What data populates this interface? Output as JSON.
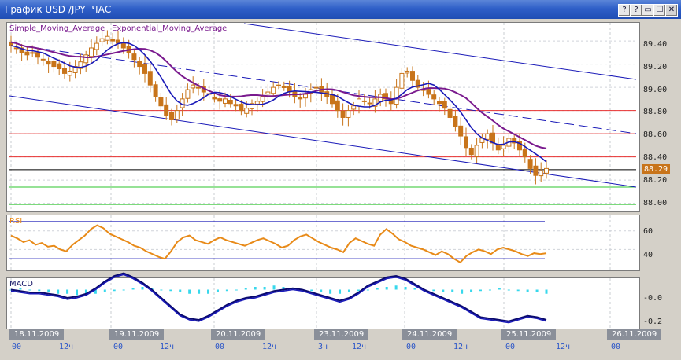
{
  "window": {
    "title": "График USD /JPY  ЧАС",
    "buttons": [
      "?",
      "?",
      "▭",
      "☐",
      "✕"
    ]
  },
  "main_legend": {
    "sma": "Simple_Moving_Average",
    "ema": "Exponential_Moving_Average"
  },
  "price_axis": [
    "89.40",
    "89.20",
    "89.00",
    "88.80",
    "88.60",
    "88.40",
    "88.20",
    "88.00"
  ],
  "current_price": "88.29",
  "rsi": {
    "label": "RSI",
    "axis": [
      "60",
      "40"
    ]
  },
  "macd": {
    "label": "MACD",
    "axis": [
      "-0.0",
      "-0.2"
    ]
  },
  "dates": [
    "18.11.2009",
    "19.11.2009",
    "20.11.2009",
    "23.11.2009",
    "24.11.2009",
    "25.11.2009",
    "26.11.2009"
  ],
  "hours": [
    "00",
    "12ч",
    "00",
    "12ч",
    "00",
    "12ч",
    "3ч",
    "12ч",
    "00",
    "12ч",
    "00",
    "12ч",
    "00"
  ],
  "colors": {
    "sma": "#7a1a8e",
    "ema": "#1a1ab8",
    "candle": "#c8741a",
    "rsi": "#e88a18",
    "macd_hist": "#38d8ec",
    "macd_line": "#0a0a6e",
    "level_red": "#e83030",
    "level_green": "#2ec42e"
  },
  "chart_data": [
    {
      "type": "candlestick",
      "title": "USD /JPY",
      "ylim": [
        87.95,
        89.55
      ],
      "price_levels_red": [
        88.8,
        88.6,
        88.4
      ],
      "price_levels_green": [
        88.14,
        87.99
      ],
      "current_level": 88.29,
      "close_series": [
        89.36,
        89.34,
        89.3,
        89.28,
        89.3,
        89.26,
        89.24,
        89.2,
        89.18,
        89.16,
        89.12,
        89.14,
        89.18,
        89.22,
        89.28,
        89.34,
        89.38,
        89.42,
        89.44,
        89.4,
        89.38,
        89.34,
        89.3,
        89.24,
        89.18,
        89.12,
        89.02,
        88.92,
        88.84,
        88.76,
        88.72,
        88.8,
        88.9,
        88.98,
        89.02,
        89.0,
        88.96,
        88.94,
        88.9,
        88.88,
        88.9,
        88.86,
        88.84,
        88.8,
        88.82,
        88.86,
        88.88,
        88.92,
        88.96,
        89.0,
        89.02,
        89.0,
        88.96,
        88.92,
        88.9,
        88.94,
        88.98,
        89.0,
        88.96,
        88.92,
        88.86,
        88.8,
        88.74,
        88.8,
        88.84,
        88.9,
        88.88,
        88.86,
        88.9,
        88.94,
        88.9,
        88.86,
        89.0,
        89.12,
        89.14,
        89.06,
        89.0,
        88.98,
        88.94,
        88.9,
        88.86,
        88.82,
        88.74,
        88.66,
        88.58,
        88.48,
        88.42,
        88.5,
        88.56,
        88.6,
        88.52,
        88.46,
        88.5,
        88.56,
        88.52,
        88.46,
        88.4,
        88.3,
        88.24,
        88.28,
        88.3
      ]
    },
    {
      "type": "line",
      "title": "RSI",
      "ylim": [
        20,
        75
      ],
      "values": [
        55,
        52,
        48,
        50,
        45,
        47,
        43,
        44,
        40,
        38,
        45,
        50,
        55,
        62,
        66,
        63,
        57,
        54,
        51,
        48,
        44,
        42,
        38,
        35,
        32,
        30,
        38,
        48,
        53,
        55,
        50,
        48,
        46,
        50,
        53,
        50,
        48,
        46,
        44,
        47,
        50,
        52,
        49,
        46,
        42,
        44,
        50,
        54,
        56,
        52,
        48,
        45,
        42,
        40,
        37,
        47,
        52,
        49,
        46,
        44,
        56,
        62,
        57,
        51,
        48,
        44,
        42,
        40,
        37,
        34,
        38,
        35,
        30,
        26,
        33,
        37,
        40,
        38,
        35,
        40,
        42,
        40,
        38,
        35,
        33,
        36,
        35,
        36
      ]
    },
    {
      "type": "line",
      "title": "MACD",
      "ylim": [
        -0.26,
        0.06
      ],
      "signal": [
        0.0,
        -0.01,
        -0.02,
        -0.02,
        -0.03,
        -0.04,
        -0.06,
        -0.05,
        -0.03,
        0.01,
        0.06,
        0.1,
        0.12,
        0.09,
        0.05,
        0.0,
        -0.06,
        -0.12,
        -0.18,
        -0.21,
        -0.22,
        -0.19,
        -0.15,
        -0.11,
        -0.08,
        -0.06,
        -0.05,
        -0.03,
        -0.01,
        0.0,
        0.01,
        0.0,
        -0.02,
        -0.04,
        -0.06,
        -0.08,
        -0.06,
        -0.02,
        0.03,
        0.06,
        0.09,
        0.1,
        0.08,
        0.04,
        0.0,
        -0.03,
        -0.06,
        -0.09,
        -0.12,
        -0.16,
        -0.2,
        -0.21,
        -0.22,
        -0.23,
        -0.21,
        -0.19,
        -0.2,
        -0.22
      ],
      "histogram": [
        0.0,
        0.01,
        0.0,
        -0.01,
        -0.02,
        -0.03,
        -0.03,
        -0.04,
        -0.04,
        -0.03,
        -0.02,
        -0.01,
        0.0,
        0.01,
        0.02,
        0.01,
        0.0,
        -0.01,
        -0.02,
        -0.03,
        -0.03,
        -0.03,
        -0.02,
        -0.01,
        0.0,
        0.01,
        0.02,
        0.02,
        0.03,
        0.02,
        0.01,
        0.0,
        -0.01,
        -0.02,
        -0.03,
        -0.03,
        -0.02,
        -0.01,
        0.0,
        0.01,
        0.02,
        0.03,
        0.02,
        0.01,
        0.0,
        -0.01,
        -0.02,
        -0.02,
        -0.03,
        -0.02,
        -0.01,
        0.0,
        0.01,
        0.0,
        -0.01,
        -0.02,
        -0.02,
        -0.03
      ]
    }
  ]
}
